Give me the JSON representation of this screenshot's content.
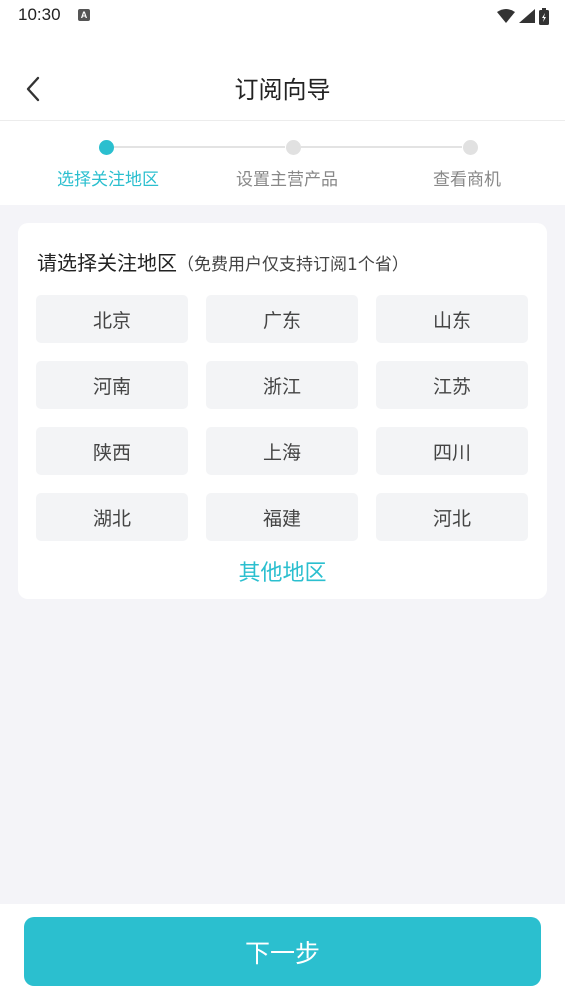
{
  "status_bar": {
    "time": "10:30",
    "notification_badge": "A",
    "icons": [
      "wifi-icon",
      "signal-icon",
      "battery-charging-icon"
    ]
  },
  "header": {
    "title": "订阅向导",
    "back_icon": "chevron-left-icon"
  },
  "steps": [
    {
      "label": "选择关注地区",
      "active": true
    },
    {
      "label": "设置主营产品",
      "active": false
    },
    {
      "label": "查看商机",
      "active": false
    }
  ],
  "region_card": {
    "title": "请选择关注地区",
    "hint": "（免费用户仅支持订阅1个省）",
    "regions": [
      "北京",
      "广东",
      "山东",
      "河南",
      "浙江",
      "江苏",
      "陕西",
      "上海",
      "四川",
      "湖北",
      "福建",
      "河北"
    ],
    "other_label": "其他地区"
  },
  "footer": {
    "next_label": "下一步"
  },
  "colors": {
    "accent": "#2bbfcf",
    "background": "#f4f4f8",
    "button_bg": "#f3f4f6"
  }
}
